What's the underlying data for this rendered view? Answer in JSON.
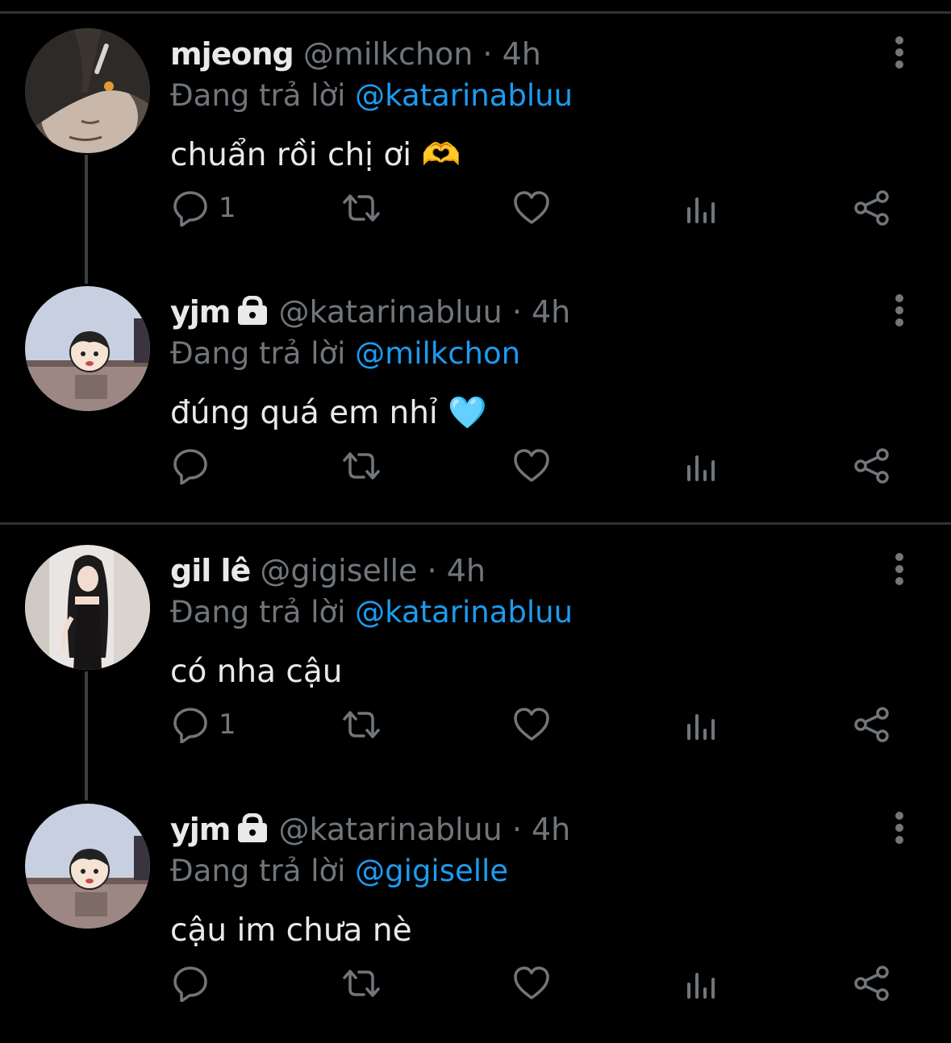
{
  "colors": {
    "background": "#000000",
    "text": "#e7e9ea",
    "muted": "#71767b",
    "link": "#1d9bf0"
  },
  "tweets": [
    {
      "name": "mjeong",
      "handle": "@milkchon",
      "dot": "·",
      "time": "4h",
      "locked": false,
      "reply_prefix": "Đang trả lời",
      "reply_to": "@katarinabluu",
      "text": "chuẩn rồi chị ơi 🫶",
      "reply_count": "1",
      "avatar": "photo-girl-hair-clip"
    },
    {
      "name": "yjm",
      "handle": "@katarinabluu",
      "dot": "·",
      "time": "4h",
      "locked": true,
      "reply_prefix": "Đang trả lời",
      "reply_to": "@milkchon",
      "text": "đúng quá em nhỉ 🩵",
      "reply_count": "",
      "avatar": "cartoon-shinchan"
    },
    {
      "name": "gil lê",
      "handle": "@gigiselle",
      "dot": "·",
      "time": "4h",
      "locked": false,
      "reply_prefix": "Đang trả lời",
      "reply_to": "@katarinabluu",
      "text": "có nha cậu",
      "reply_count": "1",
      "avatar": "photo-girl-black-dress"
    },
    {
      "name": "yjm",
      "handle": "@katarinabluu",
      "dot": "·",
      "time": "4h",
      "locked": true,
      "reply_prefix": "Đang trả lời",
      "reply_to": "@gigiselle",
      "text": "cậu im chưa nè",
      "reply_count": "",
      "avatar": "cartoon-shinchan"
    }
  ],
  "icons": [
    "reply-icon",
    "retweet-icon",
    "like-icon",
    "views-icon",
    "share-icon",
    "more-icon",
    "lock-icon"
  ]
}
